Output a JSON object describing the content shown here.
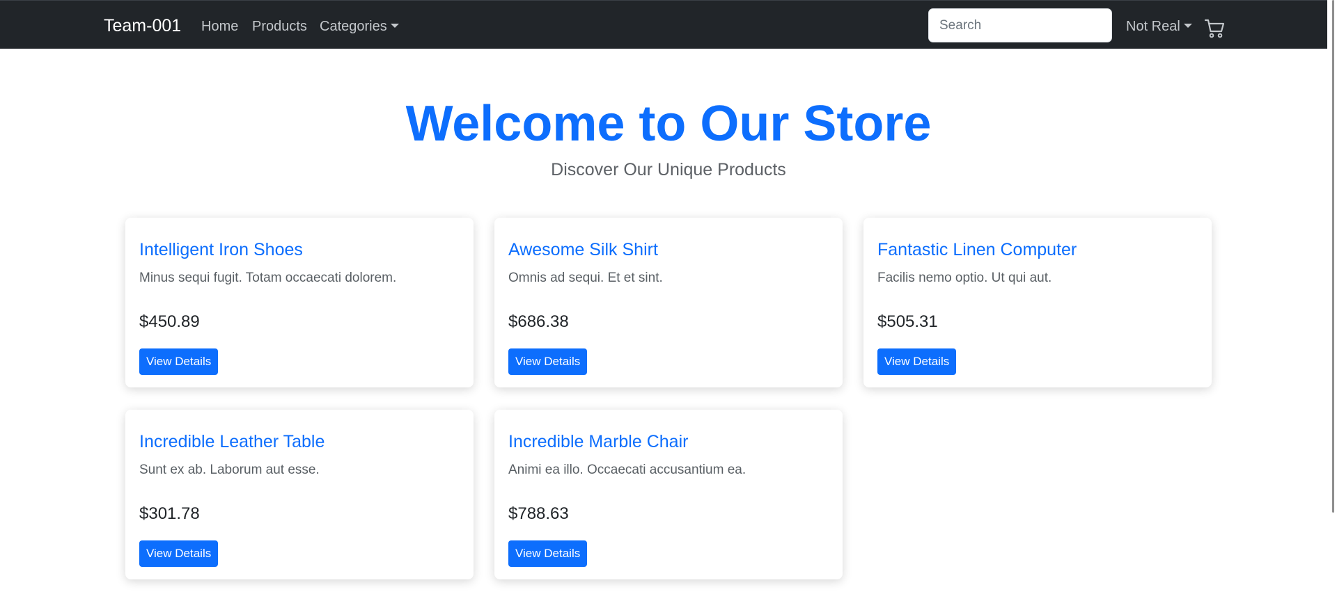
{
  "navbar": {
    "brand": "Team-001",
    "links": [
      "Home",
      "Products",
      "Categories"
    ],
    "search_placeholder": "Search",
    "user_menu": "Not Real",
    "cart_icon": "cart-icon"
  },
  "hero": {
    "title": "Welcome to Our Store",
    "subtitle": "Discover Our Unique Products"
  },
  "products": [
    {
      "name": "Intelligent Iron Shoes",
      "description": "Minus sequi fugit. Totam occaecati dolorem.",
      "price": "$450.89",
      "button": "View Details"
    },
    {
      "name": "Awesome Silk Shirt",
      "description": "Omnis ad sequi. Et et sint.",
      "price": "$686.38",
      "button": "View Details"
    },
    {
      "name": "Fantastic Linen Computer",
      "description": "Facilis nemo optio. Ut qui aut.",
      "price": "$505.31",
      "button": "View Details"
    },
    {
      "name": "Incredible Leather Table",
      "description": "Sunt ex ab. Laborum aut esse.",
      "price": "$301.78",
      "button": "View Details"
    },
    {
      "name": "Incredible Marble Chair",
      "description": "Animi ea illo. Occaecati accusantium ea.",
      "price": "$788.63",
      "button": "View Details"
    }
  ],
  "colors": {
    "navbar_bg": "#212529",
    "accent": "#0d6efd",
    "nav_link": "#c3c7cb"
  }
}
